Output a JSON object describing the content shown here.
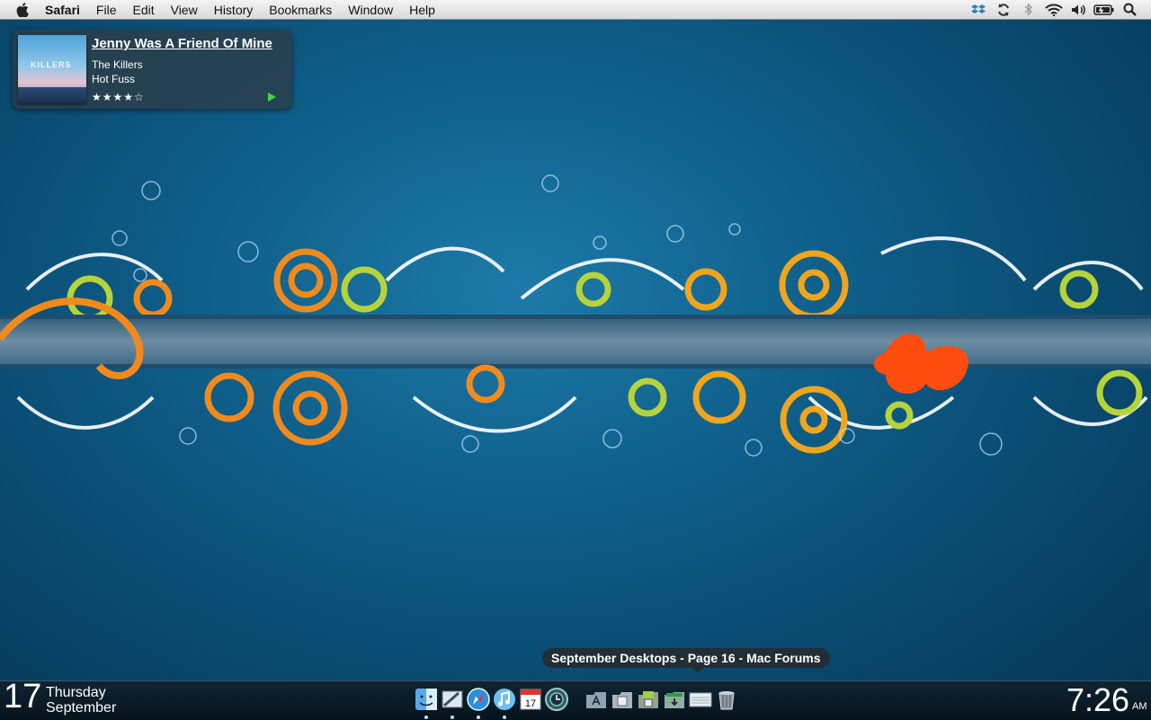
{
  "menubar": {
    "app_name": "Safari",
    "items": [
      "File",
      "Edit",
      "View",
      "History",
      "Bookmarks",
      "Window",
      "Help"
    ],
    "status_icons": [
      "dropbox-icon",
      "sync-icon",
      "bluetooth-icon",
      "wifi-icon",
      "volume-icon",
      "battery-icon",
      "spotlight-icon"
    ]
  },
  "now_playing": {
    "title": "Jenny Was A Friend Of Mine",
    "artist": "The Killers",
    "album": "Hot Fuss",
    "rating": "★★★★☆",
    "cover_text": "KILLERS"
  },
  "tooltip": {
    "text": "September Desktops - Page 16 - Mac Forums"
  },
  "date_widget": {
    "day_number": "17",
    "weekday": "Thursday",
    "month": "September"
  },
  "clock": {
    "time": "7:26",
    "ampm": "AM"
  },
  "dock": {
    "apps": [
      "finder-icon",
      "mail-icon",
      "safari-icon",
      "itunes-icon",
      "ical-icon",
      "time-machine-icon"
    ],
    "running": [
      true,
      true,
      true,
      true,
      false,
      false
    ],
    "ical_date": "17",
    "folders": [
      "applications-folder-icon",
      "documents-folder-icon",
      "stack-folder-icon",
      "downloads-folder-icon",
      "mailbox-icon",
      "trash-icon"
    ]
  }
}
